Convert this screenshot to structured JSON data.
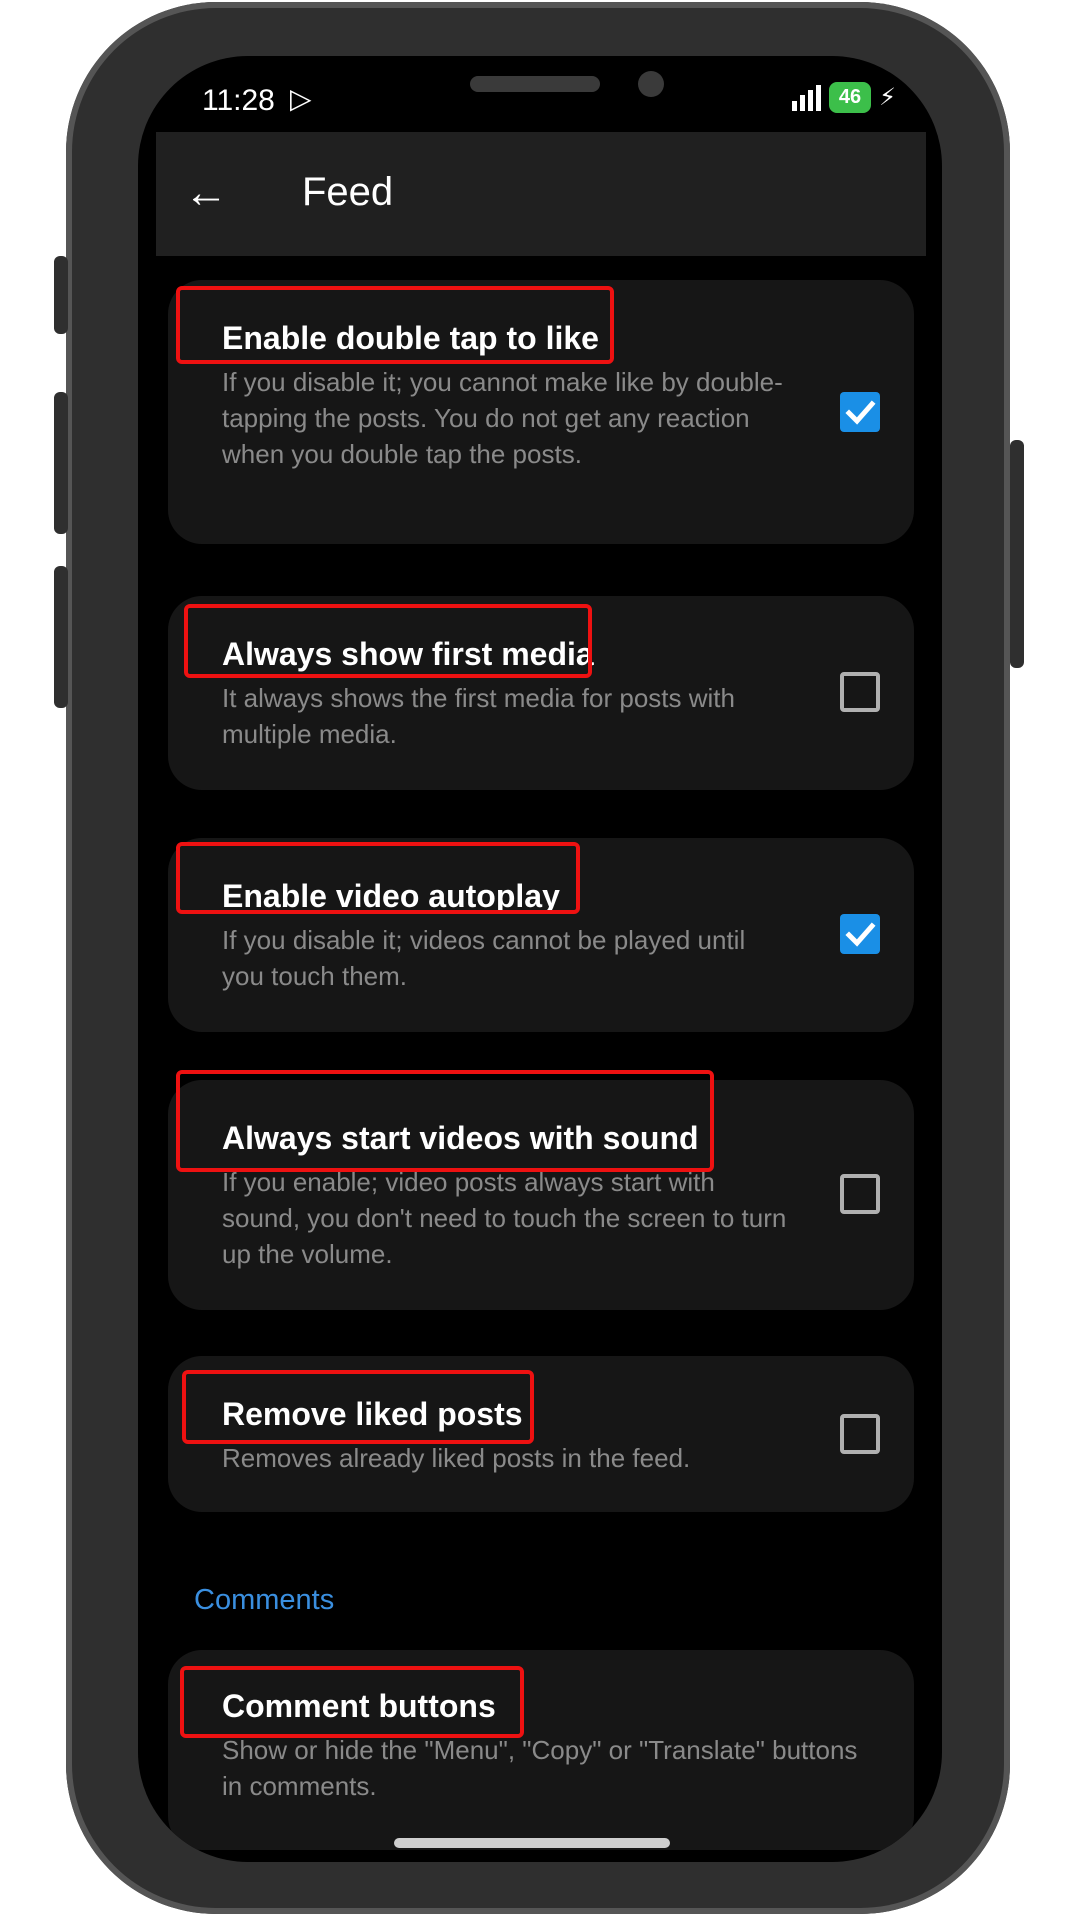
{
  "status_bar": {
    "time": "11:28",
    "play_icon": "▷",
    "battery": "46",
    "charging_icon": "⚡"
  },
  "app_bar": {
    "back_icon": "←",
    "title": "Feed"
  },
  "settings": [
    {
      "title": "Enable double tap to like",
      "description": "If you disable it; you cannot make like by double-tapping the posts. You do not get any reaction when you double tap the posts.",
      "checked": true
    },
    {
      "title": "Always show first media",
      "description": "It always shows the first media for posts with multiple media.",
      "checked": false
    },
    {
      "title": "Enable video autoplay",
      "description": "If you disable it; videos cannot be played until you touch them.",
      "checked": true
    },
    {
      "title": "Always start videos with sound",
      "description": "If you enable; video posts always start with sound, you don't need to touch the screen to turn up the volume.",
      "checked": false
    },
    {
      "title": "Remove liked posts",
      "description": "Removes already liked posts in the feed.",
      "checked": false
    }
  ],
  "comments_section": {
    "header": "Comments",
    "item_title": "Comment buttons",
    "item_description": "Show or hide the \"Menu\", \"Copy\" or \"Translate\" buttons in comments."
  },
  "colors": {
    "accent": "#1a8fe6",
    "highlight": "#ee1111",
    "card_bg": "#161616",
    "app_bar_bg": "#202020"
  }
}
